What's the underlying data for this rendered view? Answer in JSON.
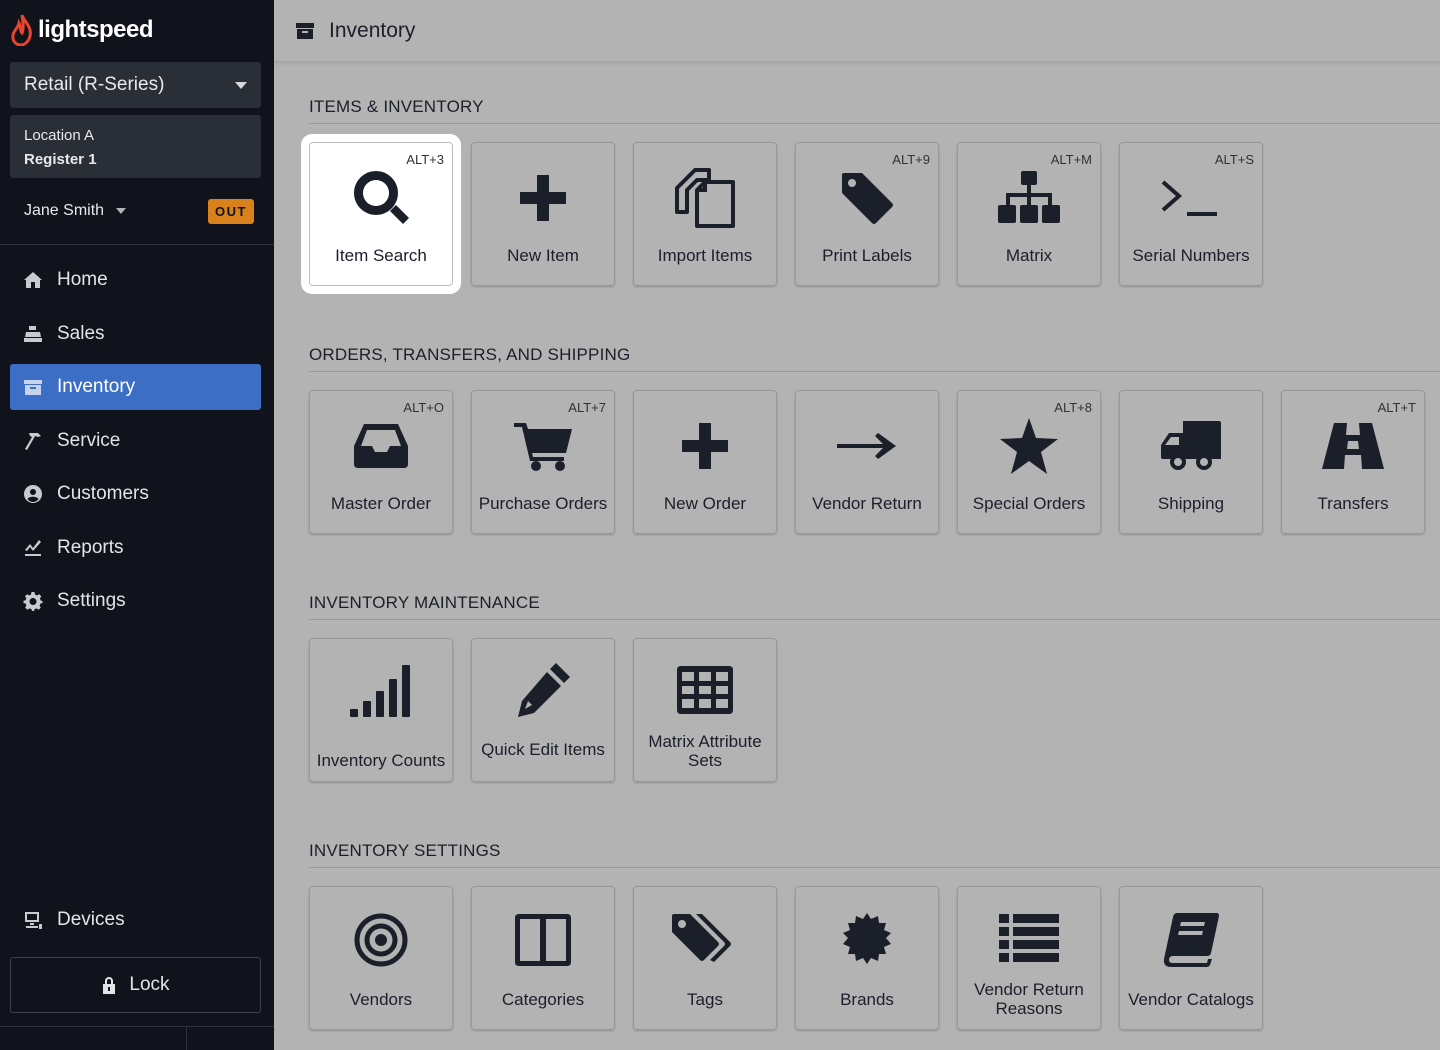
{
  "app": {
    "logo_text": "lightspeed"
  },
  "sidebar": {
    "store": "Retail (R-Series)",
    "location": "Location A",
    "register": "Register 1",
    "user": "Jane Smith",
    "status_badge": "OUT",
    "nav": [
      {
        "label": "Home",
        "icon": "home-icon"
      },
      {
        "label": "Sales",
        "icon": "register-icon"
      },
      {
        "label": "Inventory",
        "icon": "archive-icon"
      },
      {
        "label": "Service",
        "icon": "hammer-icon"
      },
      {
        "label": "Customers",
        "icon": "user-circle-icon"
      },
      {
        "label": "Reports",
        "icon": "chart-icon"
      },
      {
        "label": "Settings",
        "icon": "gear-icon"
      }
    ],
    "devices": "Devices",
    "lock": "Lock"
  },
  "header": {
    "title": "Inventory"
  },
  "sections": {
    "items": {
      "title": "ITEMS & INVENTORY",
      "tiles": [
        {
          "label": "Item Search",
          "shortcut": "ALT+3"
        },
        {
          "label": "New Item",
          "shortcut": ""
        },
        {
          "label": "Import Items",
          "shortcut": ""
        },
        {
          "label": "Print Labels",
          "shortcut": "ALT+9"
        },
        {
          "label": "Matrix",
          "shortcut": "ALT+M"
        },
        {
          "label": "Serial Numbers",
          "shortcut": "ALT+S"
        }
      ]
    },
    "orders": {
      "title": "ORDERS, TRANSFERS, AND SHIPPING",
      "tiles": [
        {
          "label": "Master Order",
          "shortcut": "ALT+O"
        },
        {
          "label": "Purchase Orders",
          "shortcut": "ALT+7"
        },
        {
          "label": "New Order",
          "shortcut": ""
        },
        {
          "label": "Vendor Return",
          "shortcut": ""
        },
        {
          "label": "Special Orders",
          "shortcut": "ALT+8"
        },
        {
          "label": "Shipping",
          "shortcut": ""
        },
        {
          "label": "Transfers",
          "shortcut": "ALT+T"
        }
      ]
    },
    "maintenance": {
      "title": "INVENTORY MAINTENANCE",
      "tiles": [
        {
          "label": "Inventory Counts",
          "shortcut": ""
        },
        {
          "label": "Quick Edit Items",
          "shortcut": ""
        },
        {
          "label": "Matrix Attribute Sets",
          "shortcut": ""
        }
      ]
    },
    "settings": {
      "title": "INVENTORY SETTINGS",
      "tiles": [
        {
          "label": "Vendors",
          "shortcut": ""
        },
        {
          "label": "Categories",
          "shortcut": ""
        },
        {
          "label": "Tags",
          "shortcut": ""
        },
        {
          "label": "Brands",
          "shortcut": ""
        },
        {
          "label": "Vendor Return Reasons",
          "shortcut": ""
        },
        {
          "label": "Vendor Catalogs",
          "shortcut": ""
        }
      ]
    }
  },
  "colors": {
    "sidebar_bg": "#10131b",
    "accent": "#3b6ec4",
    "badge": "#d9821b",
    "content_bg": "#b3b3b3"
  }
}
